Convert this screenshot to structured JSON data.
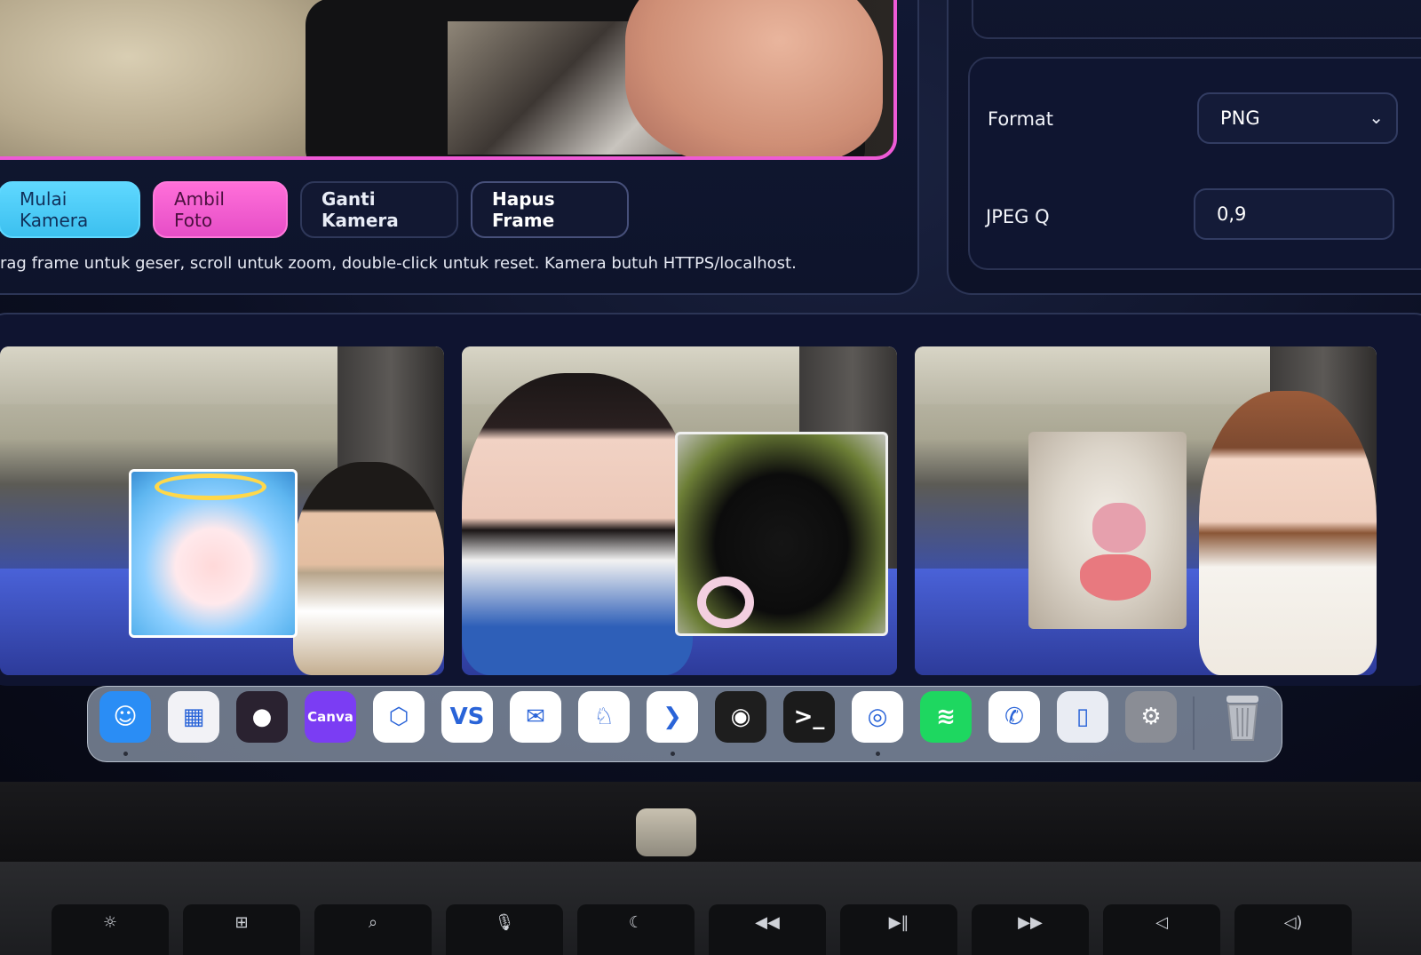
{
  "buttons": {
    "start_camera": "Mulai Kamera",
    "take_photo": "Ambil Foto",
    "switch_camera": "Ganti Kamera",
    "remove_frame": "Hapus Frame"
  },
  "hint": "rag frame untuk geser, scroll untuk zoom, double-click untuk reset. Kamera butuh HTTPS/localhost.",
  "settings": {
    "format_label": "Format",
    "format_value": "PNG",
    "jpeg_label": "JPEG Q",
    "jpeg_value": "0,9"
  },
  "gallery": {
    "photos": [
      {
        "sticker": "angel-sticker"
      },
      {
        "sticker": "black-cat-pacifier-sticker"
      },
      {
        "sticker": "white-cat-tongue-sticker"
      }
    ]
  },
  "dock": {
    "apps": [
      {
        "name": "finder-icon",
        "glyph": "☺",
        "bg": "#2a8df5",
        "running": true
      },
      {
        "name": "launchpad-icon",
        "glyph": "▦",
        "bg": "#f2f2f6",
        "running": false
      },
      {
        "name": "hamster-app-icon",
        "glyph": "●",
        "bg": "#2a2230",
        "running": false
      },
      {
        "name": "canva-icon",
        "glyph": "Canva",
        "bg": "#7b3df3",
        "running": false
      },
      {
        "name": "cube-app-icon",
        "glyph": "⬡",
        "bg": "#ffffff",
        "running": false
      },
      {
        "name": "vs-letters-icon",
        "glyph": "VS",
        "bg": "#ffffff",
        "running": false
      },
      {
        "name": "mail-search-icon",
        "glyph": "✉",
        "bg": "#ffffff",
        "running": false
      },
      {
        "name": "llama-icon",
        "glyph": "♘",
        "bg": "#ffffff",
        "running": false
      },
      {
        "name": "vscode-icon",
        "glyph": "❯",
        "bg": "#ffffff",
        "running": true
      },
      {
        "name": "figma-icon",
        "glyph": "◉",
        "bg": "#1e1e1e",
        "running": false
      },
      {
        "name": "terminal-icon",
        "glyph": ">_",
        "bg": "#1b1b1b",
        "running": false
      },
      {
        "name": "chrome-icon",
        "glyph": "◎",
        "bg": "#ffffff",
        "running": true
      },
      {
        "name": "spotify-icon",
        "glyph": "≋",
        "bg": "#1ed760",
        "running": false
      },
      {
        "name": "whatsapp-icon",
        "glyph": "✆",
        "bg": "#ffffff",
        "running": false
      },
      {
        "name": "iphone-mirroring-icon",
        "glyph": "▯",
        "bg": "#e9ecf3",
        "running": false
      },
      {
        "name": "system-settings-icon",
        "glyph": "⚙",
        "bg": "#8a8d95",
        "running": false
      }
    ],
    "trash": "trash-icon"
  },
  "keyboard": {
    "keys": [
      "☼",
      "⊞",
      "⌕",
      "🎙",
      "☾",
      "◀◀",
      "▶‖",
      "▶▶",
      "◁",
      "◁)"
    ]
  },
  "colors": {
    "accent_cyan": "#3cc0ef",
    "accent_pink": "#e64ec7",
    "frame_border": "#ee5ad6",
    "panel_bg": "#0f1430"
  }
}
